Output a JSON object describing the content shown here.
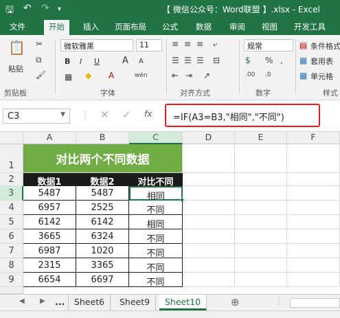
{
  "titlebar": {
    "save_icon": "save-icon",
    "undo_icon": "undo-icon",
    "redo_icon": "redo-icon",
    "title": "【 微信公众号：Word联盟 】.xlsx - Excel"
  },
  "tabs": [
    "文件",
    "开始",
    "插入",
    "页面布局",
    "公式",
    "数据",
    "审阅",
    "视图",
    "开发工具"
  ],
  "active_tab": "开始",
  "ribbon": {
    "paste_label": "粘贴",
    "font_name": "微软雅黑",
    "font_size": "11",
    "bold": "B",
    "italic": "I",
    "underline": "U",
    "grow_font": "A",
    "shrink_font": "A",
    "number_format": "规常",
    "conditional_format": "条件格式",
    "table_format": "套用表",
    "cell_style": "单元格",
    "groups": [
      "剪贴板",
      "字体",
      "对齐方式",
      "数字",
      "样式"
    ]
  },
  "formula_bar": {
    "name_box": "C3",
    "fx_label": "fx",
    "formula": "=IF(A3=B3,\"相同\",\"不同\")"
  },
  "columns": [
    "A",
    "B",
    "C",
    "D",
    "E",
    "F"
  ],
  "selected_column": "C",
  "selected_row": "3",
  "sheet": {
    "title": "对比两个不同数据",
    "headers": [
      "数据1",
      "数据2",
      "对比不同"
    ],
    "rows": [
      {
        "row": "3",
        "a": "5487",
        "b": "5487",
        "c": "相同"
      },
      {
        "row": "4",
        "a": "6957",
        "b": "2525",
        "c": "不同"
      },
      {
        "row": "5",
        "a": "6142",
        "b": "6142",
        "c": "相同"
      },
      {
        "row": "6",
        "a": "3665",
        "b": "6324",
        "c": "不同"
      },
      {
        "row": "7",
        "a": "6987",
        "b": "1020",
        "c": "不同"
      },
      {
        "row": "8",
        "a": "2315",
        "b": "3365",
        "c": "不同"
      },
      {
        "row": "9",
        "a": "6654",
        "b": "6697",
        "c": "不同"
      }
    ]
  },
  "sheet_tabs": {
    "ellipsis": "...",
    "tabs": [
      "Sheet6",
      "Sheet9",
      "Sheet10"
    ],
    "active": "Sheet10",
    "add_icon": "plus-circle-icon"
  },
  "colors": {
    "excel_green": "#217346",
    "title_fill": "#70ad47",
    "header_fill": "#1a1a1a",
    "highlight_border": "#e02020"
  }
}
